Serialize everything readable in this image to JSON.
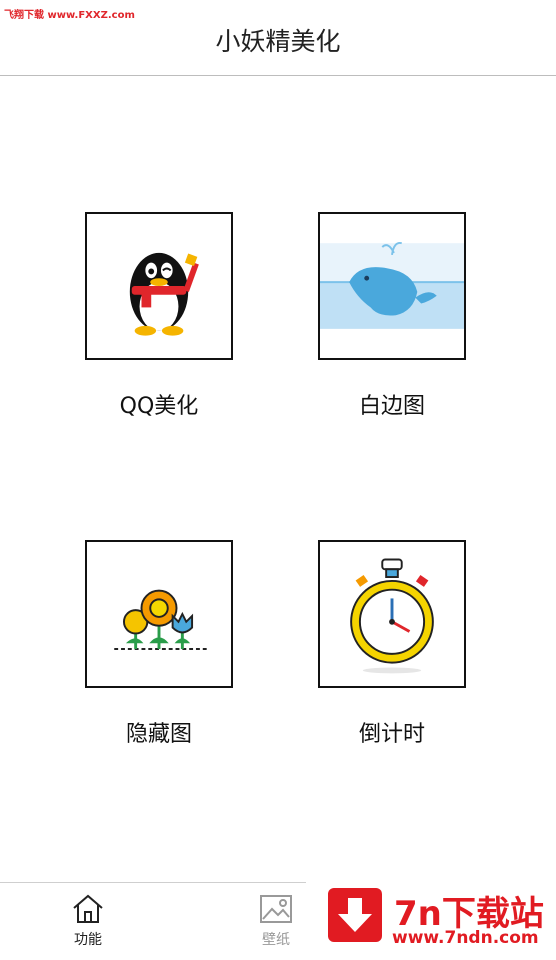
{
  "watermark_top": "飞翔下载 www.FXXZ.com",
  "header": {
    "title": "小妖精美化"
  },
  "tiles": [
    {
      "label": "QQ美化",
      "icon": "qq-penguin-icon"
    },
    {
      "label": "白边图",
      "icon": "whale-icon"
    },
    {
      "label": "隐藏图",
      "icon": "flowers-icon"
    },
    {
      "label": "倒计时",
      "icon": "stopwatch-icon"
    }
  ],
  "bottom_nav": {
    "tabs": [
      {
        "label": "功能",
        "icon": "home-icon",
        "active": true
      },
      {
        "label": "壁纸",
        "icon": "image-icon",
        "active": false
      }
    ]
  },
  "ad_badge": {
    "name": "7n下载站",
    "url": "www.7ndn.com"
  },
  "colors": {
    "accent": "#e11b22",
    "text": "#222222",
    "inactive": "#999999"
  }
}
